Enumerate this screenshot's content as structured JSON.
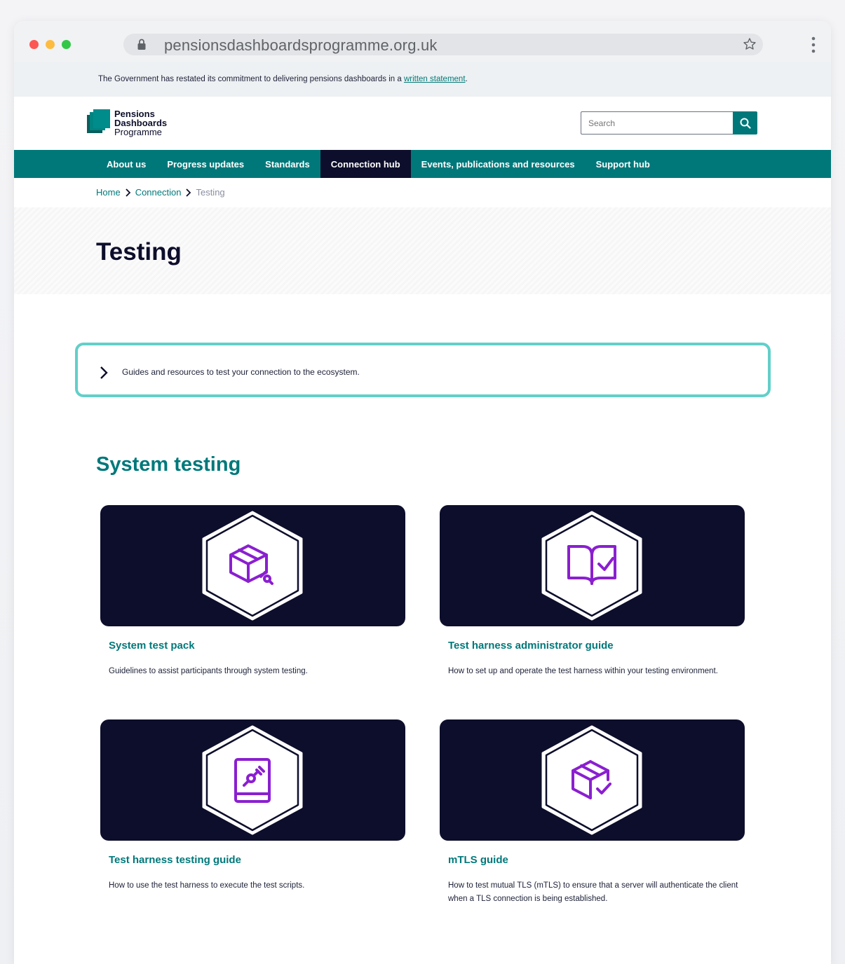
{
  "browser": {
    "url": "pensionsdashboardsprogramme.org.uk"
  },
  "announcement": {
    "text": "The Government has restated its commitment to delivering pensions dashboards in a ",
    "link": "written statement",
    "suffix": "."
  },
  "logo": {
    "line1": "Pensions",
    "line2": "Dashboards",
    "line3": "Programme"
  },
  "search": {
    "placeholder": "Search"
  },
  "nav": {
    "items": [
      "About us",
      "Progress updates",
      "Standards",
      "Connection hub",
      "Events, publications and resources",
      "Support hub"
    ],
    "active": "Connection hub"
  },
  "breadcrumb": {
    "items": [
      "Home",
      "Connection",
      "Testing"
    ]
  },
  "page": {
    "title": "Testing",
    "intro": "Guides and resources to test your connection to the ecosystem."
  },
  "section": {
    "title": "System testing",
    "cards": [
      {
        "title": "System test pack",
        "desc": "Guidelines to assist participants through system testing.",
        "icon": "package-plug-icon"
      },
      {
        "title": "Test harness administrator guide",
        "desc": "How to set up and operate the test harness within your testing environment.",
        "icon": "book-check-icon"
      },
      {
        "title": "Test harness testing guide",
        "desc": "How to use the test harness to execute the test scripts.",
        "icon": "book-plug-icon"
      },
      {
        "title": "mTLS guide",
        "desc": "How to test mutual TLS (mTLS) to ensure that a server will authenticate the client when a TLS connection is being established.",
        "icon": "package-check-icon"
      }
    ]
  },
  "colors": {
    "teal": "#00787a",
    "navy": "#0d0e2b",
    "accent_border": "#62cfc9",
    "icon_purple": "#8a1fd0"
  }
}
